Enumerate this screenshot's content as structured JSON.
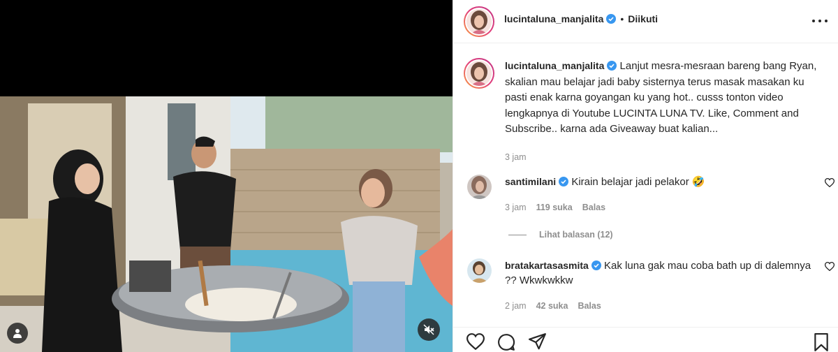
{
  "post": {
    "username": "lucintaluna_manjalita",
    "follow_status": "Diikuti",
    "separator": "•"
  },
  "caption": {
    "username": "lucintaluna_manjalita",
    "text": "Lanjut mesra-mesraan bareng bang Ryan, skalian mau belajar jadi baby sisternya terus masak masakan ku pasti enak karna goyangan ku yang hot.. cusss tonton video lengkapnya di Youtube LUCINTA LUNA TV. Like, Comment and Subscribe.. karna ada Giveaway buat kalian...",
    "time": "3 jam"
  },
  "comments": [
    {
      "username": "santimilani",
      "text": "Kirain belajar jadi pelakor 🤣",
      "time": "3 jam",
      "likes": "119 suka",
      "reply_label": "Balas",
      "view_replies": "Lihat balasan (12)"
    },
    {
      "username": "bratakartasasmita",
      "text": "Kak luna gak mau coba bath up di dalemnya ?? Wkwkwkkw",
      "time": "2 jam",
      "likes": "42 suka",
      "reply_label": "Balas"
    }
  ],
  "icons": {
    "verified": "verified-badge-icon",
    "more": "more-options-icon",
    "like": "heart-icon",
    "comment": "comment-icon",
    "share": "share-icon",
    "save": "bookmark-icon",
    "tag": "user-tag-icon",
    "mute": "muted-speaker-icon"
  },
  "colors": {
    "verified_blue": "#3897f0",
    "muted_text": "#8e8e8e",
    "primary_text": "#262626",
    "divider": "#efefef"
  }
}
